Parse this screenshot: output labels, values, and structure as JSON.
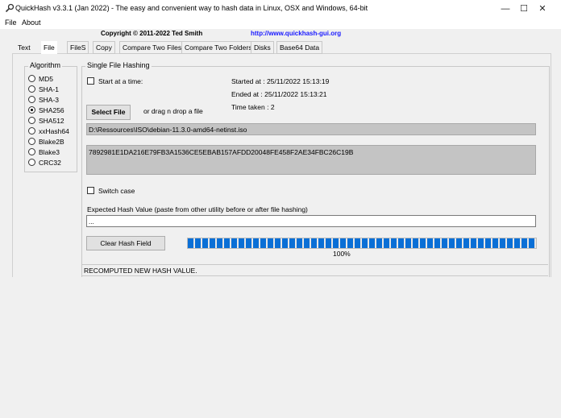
{
  "window": {
    "title": "QuickHash v3.3.1 (Jan 2022) - The easy and convenient way to hash data in Linux, OSX and Windows, 64-bit",
    "icon": "magnifier-icon",
    "minimize_glyph": "—",
    "maximize_glyph": "☐",
    "close_glyph": "✕"
  },
  "menu": [
    "File",
    "About"
  ],
  "header": {
    "copyright": "Copyright © 2011-2022  Ted Smith",
    "website": "http://www.quickhash-gui.org"
  },
  "tabs": [
    "Text",
    "File",
    "FileS",
    "Copy",
    "Compare Two Files",
    "Compare Two Folders",
    "Disks",
    "Base64 Data"
  ],
  "active_tab": "File",
  "algorithm": {
    "title": "Algorithm",
    "options": [
      "MD5",
      "SHA-1",
      "SHA-3",
      "SHA256",
      "SHA512",
      "xxHash64",
      "Blake2B",
      "Blake3",
      "CRC32"
    ],
    "selected": "SHA256"
  },
  "single_file": {
    "title": "Single File Hashing",
    "start_at_time_label": "Start at a time:",
    "started_at": "Started at : 25/11/2022 15:13:19",
    "ended_at": "Ended at : 25/11/2022 15:13:21",
    "time_taken": "Time taken : 2",
    "select_file_label": "Select File",
    "drag_drop_hint": "or drag n drop a file",
    "file_path": "D:\\Ressources\\ISO\\debian-11.3.0-amd64-netinst.iso",
    "hash_value": "7892981E1DA216E79FB3A1536CE5EBAB157AFDD20048FE458F2AE34FBC26C19B",
    "switch_case_label": "Switch case",
    "expected_hash_label": "Expected Hash Value (paste from other utility before or after file hashing)",
    "expected_hash_value": "...",
    "clear_hash_label": "Clear Hash Field",
    "progress_fraction": 1.0,
    "progress_text": "100%",
    "status_text": "RECOMPUTED NEW HASH VALUE."
  },
  "colors": {
    "progress": "#0a6fd6",
    "link": "#1a1aff",
    "field_gray": "#c4c4c4"
  }
}
